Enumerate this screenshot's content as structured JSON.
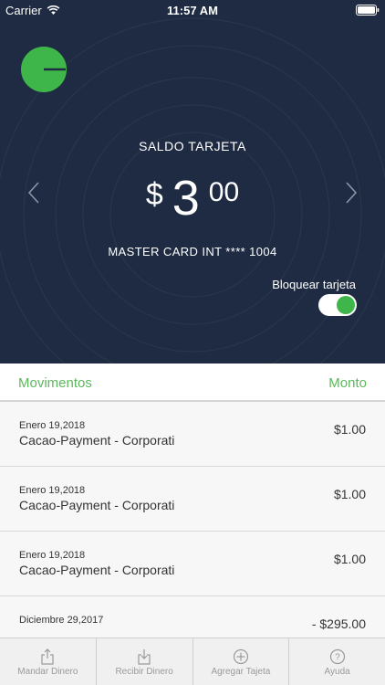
{
  "status_bar": {
    "carrier": "Carrier",
    "time": "11:57 AM"
  },
  "balance": {
    "label": "SALDO TARJETA",
    "currency": "$",
    "integer": "3",
    "decimals": "00",
    "card_name": "MASTER CARD INT **** 1004"
  },
  "block_card": {
    "label": "Bloquear tarjeta",
    "enabled": true
  },
  "movements_header": {
    "left": "Movimentos",
    "right": "Monto"
  },
  "movements": [
    {
      "date": "Enero 19,2018",
      "description": "Cacao-Payment - Corporati",
      "amount": "$1.00"
    },
    {
      "date": "Enero 19,2018",
      "description": "Cacao-Payment - Corporati",
      "amount": "$1.00"
    },
    {
      "date": "Enero 19,2018",
      "description": "Cacao-Payment - Corporati",
      "amount": "$1.00"
    },
    {
      "date": "Diciembre 29,2017",
      "description": "",
      "amount": "- $295.00"
    }
  ],
  "tabs": [
    {
      "label": "Mandar Dinero",
      "icon": "share-upload-icon"
    },
    {
      "label": "Recibir Dinero",
      "icon": "download-icon"
    },
    {
      "label": "Agregar Tajeta",
      "icon": "plus-circle-icon"
    },
    {
      "label": "Ayuda",
      "icon": "help-circle-icon"
    }
  ],
  "colors": {
    "hero_bg": "#1e2b42",
    "accent_green": "#3fb64a",
    "header_green": "#5cb85c"
  }
}
